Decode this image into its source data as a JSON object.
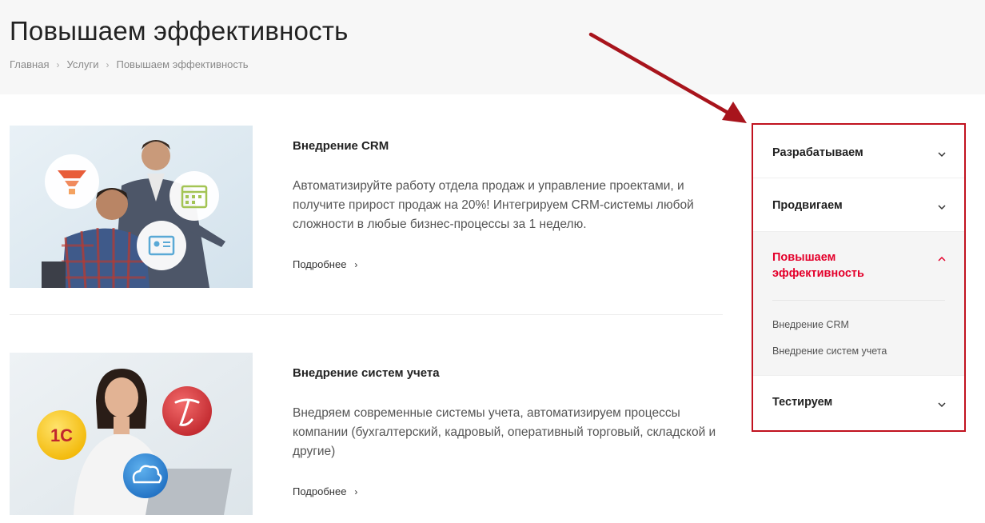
{
  "header": {
    "title": "Повышаем эффективность",
    "breadcrumb": [
      "Главная",
      "Услуги",
      "Повышаем эффективность"
    ]
  },
  "cards": [
    {
      "title": "Внедрение CRM",
      "description": "Автоматизируйте работу отдела продаж и управление проектами, и получите прирост продаж на 20%! Интегрируем CRM-системы любой сложности в любые бизнес-процессы за 1 неделю.",
      "more": "Подробнее"
    },
    {
      "title": "Внедрение систем учета",
      "description": "Внедряем современные системы учета, автоматизируем процессы компании (бухгалтерский, кадровый, оперативный торговый, складской и другие)",
      "more": "Подробнее"
    }
  ],
  "sidebar": {
    "items": [
      {
        "label": "Разрабатываем",
        "expanded": false
      },
      {
        "label": "Продвигаем",
        "expanded": false
      },
      {
        "label": "Повышаем эффективность",
        "expanded": true,
        "sub": [
          "Внедрение CRM",
          "Внедрение систем учета"
        ]
      },
      {
        "label": "Тестируем",
        "expanded": false
      }
    ]
  },
  "icons": {
    "onec_badge": "1С"
  },
  "colors": {
    "accent": "#e4002b",
    "highlight_border": "#c1121f"
  }
}
